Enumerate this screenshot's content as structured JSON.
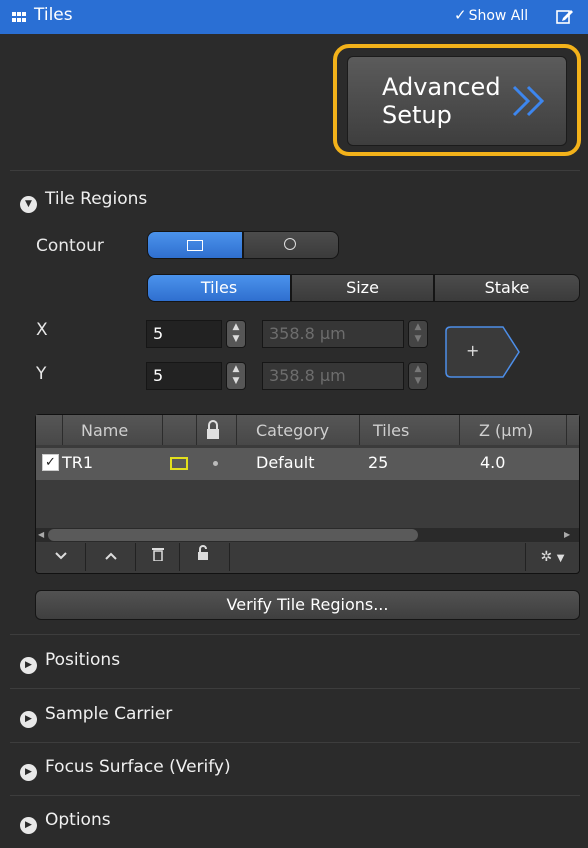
{
  "panel": {
    "title": "Tiles",
    "show_all_label": "Show All",
    "title_icon": "tiles-grid-icon",
    "edit_icon": "edit-icon"
  },
  "advanced": {
    "label": "Advanced\nSetup",
    "highlight_color": "#f3b21a"
  },
  "tile_regions": {
    "header": "Tile Regions",
    "contour_label": "Contour",
    "contour_options": [
      "rectangle",
      "circle"
    ],
    "contour_selected": "rectangle",
    "mode_tabs": [
      "Tiles",
      "Size",
      "Stake"
    ],
    "mode_selected": "Tiles",
    "x_label": "X",
    "y_label": "Y",
    "x_tiles": "5",
    "y_tiles": "5",
    "x_size": "358.8 µm",
    "y_size": "358.8 µm",
    "add_label": "+",
    "table": {
      "columns": [
        "Name",
        "",
        "",
        "Category",
        "Tiles",
        "Z (µm)"
      ],
      "rows": [
        {
          "checked": true,
          "name": "TR1",
          "category": "Default",
          "tiles": "25",
          "z": "4.0"
        }
      ]
    },
    "verify_label": "Verify Tile Regions..."
  },
  "sections": [
    {
      "label": "Positions"
    },
    {
      "label": "Sample Carrier"
    },
    {
      "label": "Focus Surface (Verify)"
    },
    {
      "label": "Options"
    }
  ],
  "colors": {
    "accent_blue": "#2a6fd4",
    "panel_bg": "#2b2b2b",
    "highlight": "#f3b21a"
  }
}
